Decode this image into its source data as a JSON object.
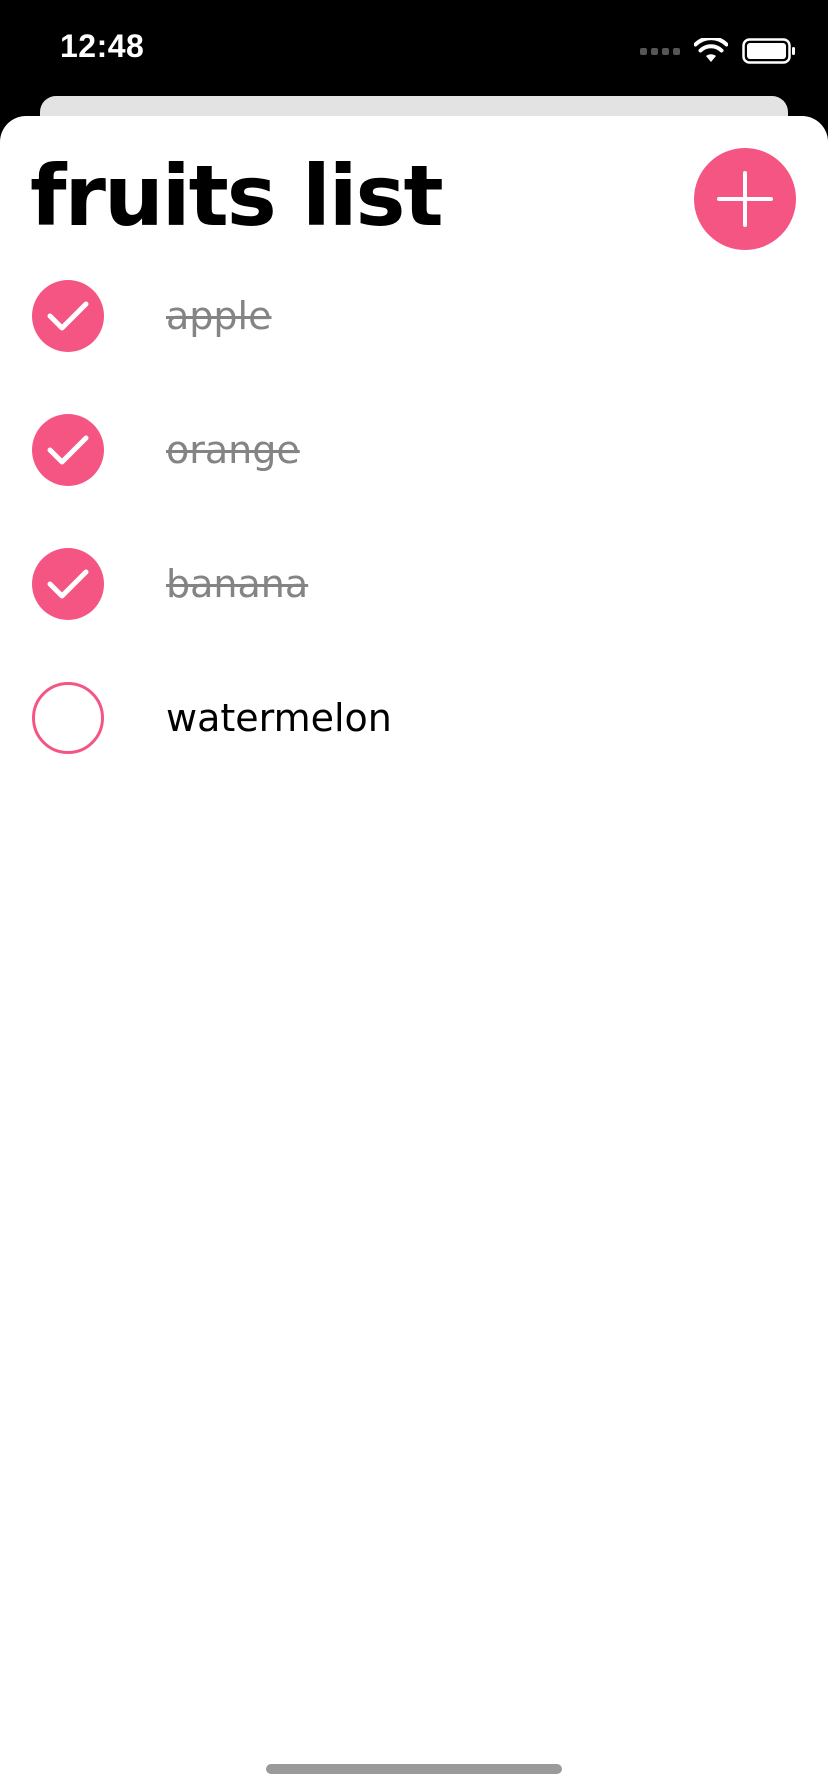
{
  "status_bar": {
    "time": "12:48"
  },
  "header": {
    "title": "fruits list",
    "add_icon": "plus-icon"
  },
  "items": [
    {
      "label": "apple",
      "checked": true
    },
    {
      "label": "orange",
      "checked": true
    },
    {
      "label": "banana",
      "checked": true
    },
    {
      "label": "watermelon",
      "checked": false
    }
  ],
  "colors": {
    "accent": "#f55583",
    "completed_text": "#848484",
    "text": "#000000"
  }
}
